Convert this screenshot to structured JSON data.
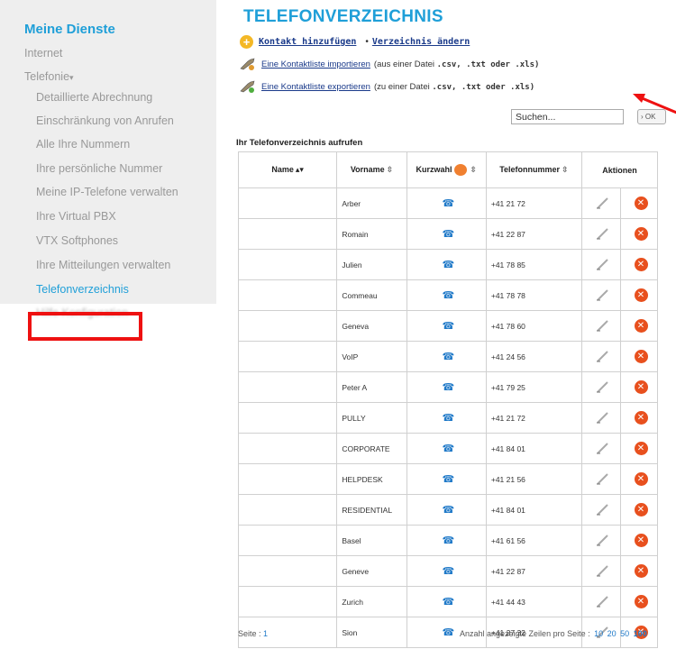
{
  "sidebar": {
    "title": "Meine Dienste",
    "items": [
      {
        "label": "Internet"
      },
      {
        "label": "Telefonie"
      }
    ],
    "submenu": [
      {
        "label": "Detaillierte Abrechnung"
      },
      {
        "label": "Einschränkung von Anrufen"
      },
      {
        "label": "Alle Ihre Nummern"
      },
      {
        "label": "Ihre persönliche Nummer"
      },
      {
        "label": "Meine IP-Telefone verwalten"
      },
      {
        "label": "Ihre Virtual PBX"
      },
      {
        "label": "VTX Softphones"
      },
      {
        "label": "Ihre Mitteilungen verwalten"
      },
      {
        "label": "Telefonverzeichnis",
        "active": true
      },
      {
        "label": "Hilfe Konfiguration",
        "blurred": true
      }
    ]
  },
  "page": {
    "title": "TELEFONVERZEICHNIS",
    "add_contact": "Kontakt hinzufügen",
    "edit_directory": "Verzeichnis ändern",
    "import_link": "Eine Kontaktliste importieren",
    "import_note_prefix": "(aus einer Datei",
    "export_link": "Eine Kontaktliste exportieren",
    "export_note_prefix": "(zu einer Datei",
    "file_types": ".csv, .txt oder .xls)"
  },
  "search": {
    "placeholder": "Suchen...",
    "button": "› OK"
  },
  "table": {
    "caption": "Ihr Telefonverzeichnis aufrufen",
    "headers": {
      "name": "Name",
      "vorname": "Vorname",
      "kurzwahl": "Kurzwahl",
      "telefon": "Telefonnummer",
      "aktionen": "Aktionen"
    },
    "rows": [
      {
        "name": "",
        "vorname": "Arber",
        "phone": "+41 21 72"
      },
      {
        "name": "",
        "vorname": "Romain",
        "phone": "+41 22 87"
      },
      {
        "name": "",
        "vorname": "Julien",
        "phone": "+41 78 85"
      },
      {
        "name": "",
        "vorname": "Commeau",
        "phone": "+41 78 78"
      },
      {
        "name": "",
        "vorname": "Geneva",
        "phone": "+41 78 60"
      },
      {
        "name": "",
        "vorname": "VoIP",
        "phone": "+41 24 56"
      },
      {
        "name": "",
        "vorname": "Peter A",
        "phone": "+41 79 25"
      },
      {
        "name": "",
        "vorname": "PULLY",
        "phone": "+41 21 72"
      },
      {
        "name": "",
        "vorname": "CORPORATE",
        "phone": "+41 84 01"
      },
      {
        "name": "",
        "vorname": "HELPDESK",
        "phone": "+41 21 56"
      },
      {
        "name": "",
        "vorname": "RESIDENTIAL",
        "phone": "+41 84 01"
      },
      {
        "name": "",
        "vorname": "Basel",
        "phone": "+41 61 56"
      },
      {
        "name": "",
        "vorname": "Geneve",
        "phone": "+41 22 87"
      },
      {
        "name": "",
        "vorname": "Zurich",
        "phone": "+41 44 43"
      },
      {
        "name": "",
        "vorname": "Sion",
        "phone": "+41 27 32"
      }
    ]
  },
  "footer": {
    "page_label": "Seite :",
    "page_number": "1",
    "rows_label": "Anzahl angezeigte Zeilen pro Seite :",
    "page_sizes": [
      "10",
      "20",
      "50",
      "100"
    ],
    "current_page_size": "100"
  },
  "colors": {
    "accent": "#1f9fd8",
    "link": "#1a3a8a",
    "highlight_box": "#ee1111",
    "delete": "#e8501e"
  },
  "icons": {
    "add": "plus-circle-icon",
    "import": "wrench-import-icon",
    "export": "wrench-export-icon",
    "kurzwahl": "speed-dial-icon",
    "phone": "phone-icon",
    "edit": "edit-pencil-icon",
    "delete": "delete-x-icon"
  }
}
